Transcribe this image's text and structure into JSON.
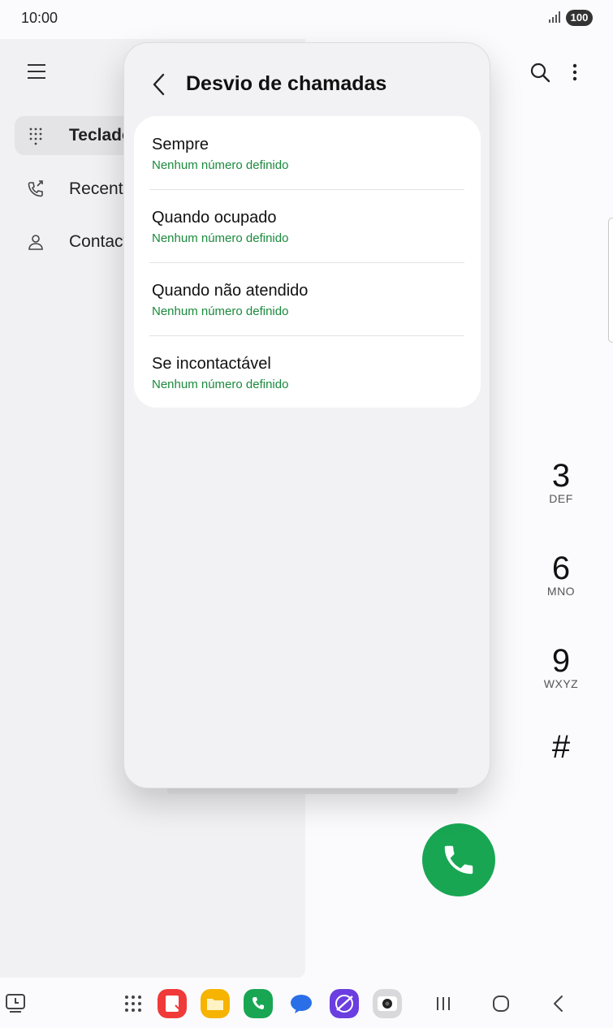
{
  "status_bar": {
    "time": "10:00",
    "battery": "100"
  },
  "left_pane": {
    "nav": [
      {
        "label": "Teclado",
        "icon": "keypad-icon",
        "active": true
      },
      {
        "label": "Recentes",
        "icon": "recent-calls-icon",
        "active": false
      },
      {
        "label": "Contactos",
        "icon": "contacts-icon",
        "active": false
      }
    ]
  },
  "dialpad": {
    "keys": [
      {
        "num": "3",
        "letters": "DEF"
      },
      {
        "num": "6",
        "letters": "MNO"
      },
      {
        "num": "9",
        "letters": "WXYZ"
      }
    ],
    "hash": "#"
  },
  "popup": {
    "title": "Desvio de chamadas",
    "options": [
      {
        "title": "Sempre",
        "subtitle": "Nenhum número definido"
      },
      {
        "title": "Quando ocupado",
        "subtitle": "Nenhum número definido"
      },
      {
        "title": "Quando não atendido",
        "subtitle": "Nenhum número definido"
      },
      {
        "title": "Se incontactável",
        "subtitle": "Nenhum número definido"
      }
    ]
  },
  "colors": {
    "accent_green": "#18a653",
    "subtitle_green": "#1a8a3c"
  },
  "taskbar": {
    "apps": [
      "app-drawer-icon",
      "notes-app-icon",
      "files-app-icon",
      "phone-app-icon",
      "messages-app-icon",
      "internet-app-icon",
      "camera-app-icon"
    ],
    "nav": [
      "recents-nav-icon",
      "home-nav-icon",
      "back-nav-icon"
    ]
  }
}
